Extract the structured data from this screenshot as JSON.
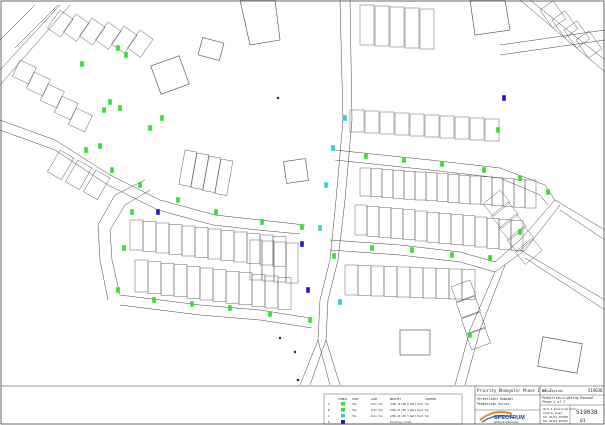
{
  "drawing": {
    "title_line": "Priority Bhangalor Phase 1 of 2",
    "drawing_ref_top": "519038",
    "project_label": "Streetlight Remodel",
    "project_sub": "Pedestrian Survey",
    "description_label": "Description",
    "description_value": "Pedestrian/Lighting Renewal",
    "phase_text": "Phase 1 of 2",
    "drawing_number": "519038",
    "revision": "01",
    "company_name": "SPECTRUM",
    "company_tagline": "lighting & infrastructure",
    "company_address": [
      "Unit 4 Riverside Park",
      "Station Road",
      "Tel 01234 567890",
      "Fax 01234 567891"
    ]
  },
  "legend": {
    "headers": [
      "SYMBOL",
      "CODE",
      "LAMP",
      "BRACKET",
      "LANTERN"
    ],
    "rows": [
      {
        "code": "A",
        "symbol": "green-lamp-marker",
        "lamp": "70w",
        "bracket": "Post Top",
        "lantern": "LUMA 24 LED 5 Watt Post Top"
      },
      {
        "code": "B",
        "symbol": "green-lamp-marker",
        "lamp": "70w",
        "bracket": "Post Top",
        "lantern": "LUMA 24 LED 3 Watt Post Top"
      },
      {
        "code": "C",
        "symbol": "cyan-lamp-marker",
        "lamp": "70w",
        "bracket": "Post Top",
        "lantern": "LUMA 24 LED 5 Watt Post Top"
      },
      {
        "code": "D",
        "symbol": "blue-lamp-marker",
        "lamp": "",
        "bracket": "",
        "lantern": "Existing column"
      }
    ]
  },
  "colors": {
    "line": "#333333",
    "background": "#ffffff",
    "new_lamp": "#33dd33",
    "alt_lamp": "#33cccc",
    "existing_lamp": "#1a1acc",
    "logo_accent": "#e38a1e"
  }
}
